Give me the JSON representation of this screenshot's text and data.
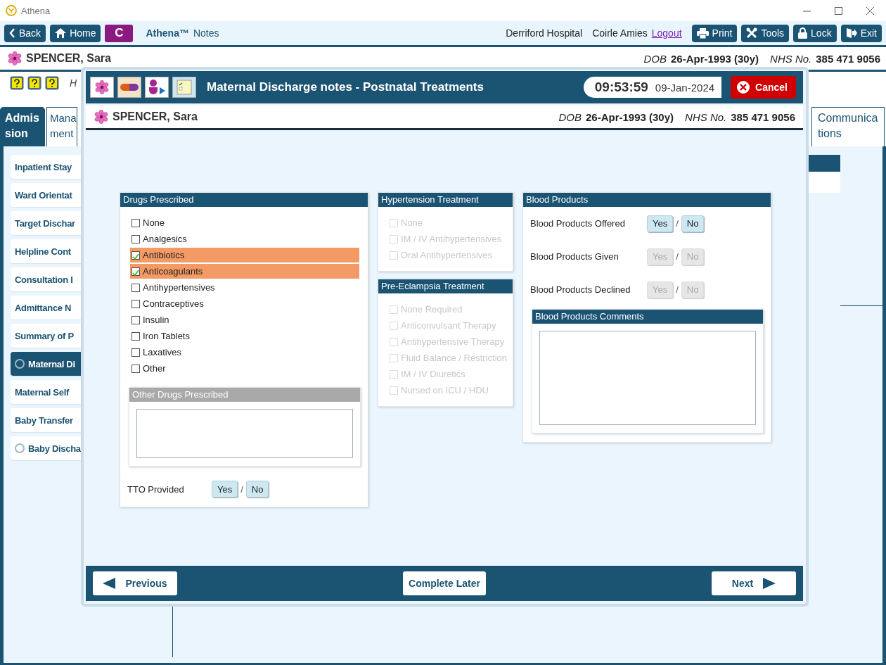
{
  "window": {
    "title": "Athena"
  },
  "toolbar": {
    "back": "Back",
    "home": "Home",
    "app_badge": "C",
    "brand": "Athena™",
    "product": "Notes",
    "hospital": "Derriford Hospital",
    "user": "Coirle Amies",
    "logout": "Logout",
    "buttons": [
      {
        "label": "Print",
        "kind": "print"
      },
      {
        "label": "Tools",
        "kind": "tools"
      },
      {
        "label": "Lock",
        "kind": "lock"
      },
      {
        "label": "Exit",
        "kind": "exit"
      }
    ]
  },
  "patient": {
    "name": "SPENCER, Sara",
    "dob_label": "DOB",
    "dob": "26-Apr-1993 (30y)",
    "nhs_label": "NHS No.",
    "nhs": "385 471 9056"
  },
  "alerts": {
    "note": "H"
  },
  "tabs": [
    {
      "label": "Admission",
      "selected": true
    },
    {
      "label": "Mana ment",
      "selected": false
    },
    {
      "label": "Communications",
      "selected": false
    }
  ],
  "sidebar": {
    "items": [
      {
        "label": "Inpatient Stay",
        "kind": "plain",
        "selected": false
      },
      {
        "label": "Ward Orientat",
        "kind": "plain",
        "selected": false
      },
      {
        "label": "Target Dischar",
        "kind": "plain",
        "selected": false
      },
      {
        "label": "Helpline Cont",
        "kind": "plain",
        "selected": false
      },
      {
        "label": "Consultation I",
        "kind": "plain",
        "selected": false
      },
      {
        "label": "Admittance N",
        "kind": "plain",
        "selected": false
      },
      {
        "label": "Summary of P",
        "kind": "plain",
        "selected": false
      },
      {
        "label": "Maternal Di",
        "kind": "radio",
        "selected": true
      },
      {
        "label": "Maternal Self",
        "kind": "plain",
        "selected": false
      },
      {
        "label": "Baby Transfer",
        "kind": "plain",
        "selected": false
      },
      {
        "label": "Baby Discha",
        "kind": "radio",
        "selected": false
      }
    ]
  },
  "dialog": {
    "title": "Maternal Discharge notes - Postnatal Treatments",
    "time": "09:53:59",
    "date": "09-Jan-2024",
    "cancel": "Cancel",
    "patient": {
      "name": "SPENCER, Sara",
      "dob_label": "DOB",
      "dob": "26-Apr-1993 (30y)",
      "nhs_label": "NHS No.",
      "nhs": "385 471 9056"
    },
    "drugs": {
      "title": "Drugs Prescribed",
      "items": [
        {
          "label": "None",
          "checked": false,
          "disabled": false
        },
        {
          "label": "Analgesics",
          "checked": false,
          "disabled": false
        },
        {
          "label": "Antibiotics",
          "checked": true,
          "disabled": false
        },
        {
          "label": "Anticoagulants",
          "checked": true,
          "disabled": false
        },
        {
          "label": "Antihypertensives",
          "checked": false,
          "disabled": false
        },
        {
          "label": "Contraceptives",
          "checked": false,
          "disabled": false
        },
        {
          "label": "Insulin",
          "checked": false,
          "disabled": false
        },
        {
          "label": "Iron Tablets",
          "checked": false,
          "disabled": false
        },
        {
          "label": "Laxatives",
          "checked": false,
          "disabled": false
        },
        {
          "label": "Other",
          "checked": false,
          "disabled": false
        }
      ],
      "other": {
        "title": "Other Drugs Prescribed",
        "disabled": true
      },
      "tto": {
        "label": "TTO Provided",
        "yes": "Yes",
        "separator": "/",
        "no": "No",
        "disabled": false
      }
    },
    "hypertension": {
      "title": "Hypertension Treatment",
      "items": [
        {
          "label": "None",
          "checked": false,
          "disabled": true
        },
        {
          "label": "IM / IV Antihypertensives",
          "checked": false,
          "disabled": true
        },
        {
          "label": "Oral Antihypertensives",
          "checked": false,
          "disabled": true
        }
      ]
    },
    "pre_eclampsia": {
      "title": "Pre-Eclampsia Treatment",
      "items": [
        {
          "label": "None Required",
          "checked": false,
          "disabled": true
        },
        {
          "label": "Anticonvulsant Therapy",
          "checked": false,
          "disabled": true
        },
        {
          "label": "Antihypertensive Therapy",
          "checked": false,
          "disabled": true
        },
        {
          "label": "Fluid Balance / Restriction",
          "checked": false,
          "disabled": true
        },
        {
          "label": "IM / IV Diuretics",
          "checked": false,
          "disabled": true
        },
        {
          "label": "Nursed on ICU / HDU",
          "checked": false,
          "disabled": true
        }
      ]
    },
    "blood": {
      "title": "Blood Products",
      "rows": [
        {
          "label": "Blood Products Offered",
          "yes": "Yes",
          "separator": "/",
          "no": "No",
          "disabled": false
        },
        {
          "label": "Blood Products Given",
          "yes": "Yes",
          "separator": "/",
          "no": "No",
          "disabled": true
        },
        {
          "label": "Blood Products Declined",
          "yes": "Yes",
          "separator": "/",
          "no": "No",
          "disabled": true
        }
      ],
      "comments": {
        "title": "Blood Products Comments",
        "disabled": false
      }
    },
    "footer": {
      "previous": "Previous",
      "complete_later": "Complete Later",
      "next": "Next"
    }
  }
}
